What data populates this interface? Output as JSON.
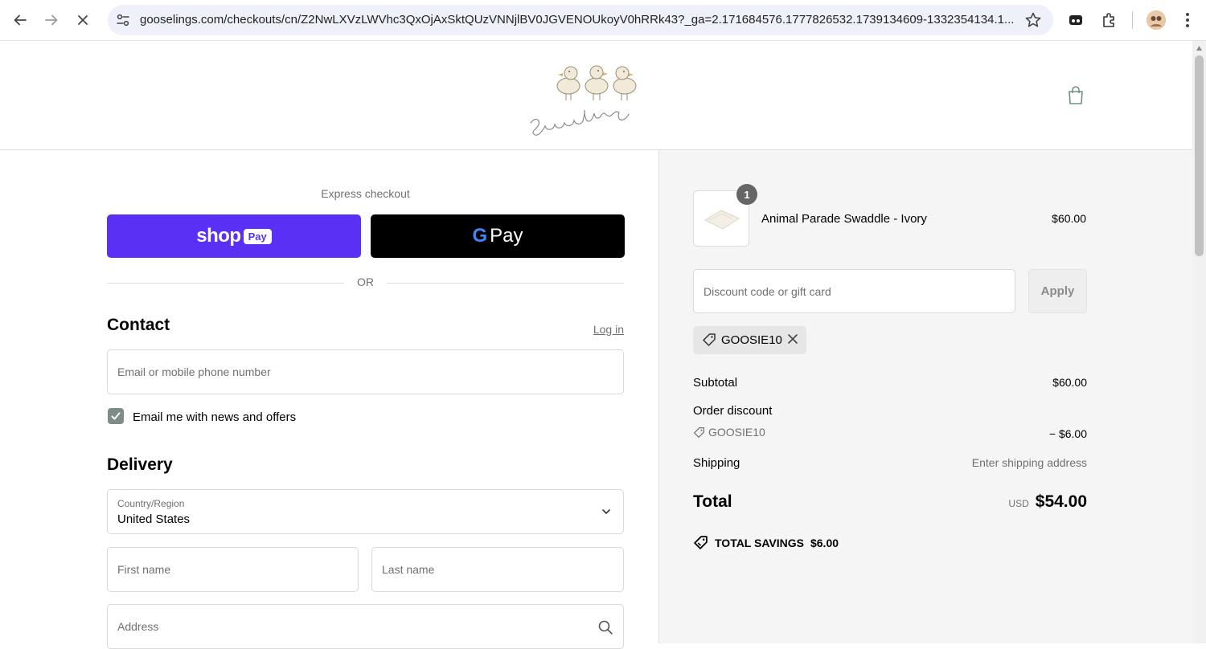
{
  "browser": {
    "url": "gooselings.com/checkouts/cn/Z2NwLXVzLWVhc3QxOjAxSktQUzVNNjlBV0JGVENOUkoyV0hRRk43?_ga=2.171684576.1777826532.1739134609-1332354134.1..."
  },
  "logo": {
    "text": "gooselings"
  },
  "express": {
    "label": "Express checkout",
    "shoppay_word": "shop",
    "shoppay_pill": "Pay",
    "gpay_g": "G",
    "gpay_word": "Pay",
    "or": "OR"
  },
  "contact": {
    "title": "Contact",
    "login": "Log in",
    "email_placeholder": "Email or mobile phone number",
    "newsletter_label": "Email me with news and offers",
    "newsletter_checked": true
  },
  "delivery": {
    "title": "Delivery",
    "country_label": "Country/Region",
    "country_value": "United States",
    "first_name_placeholder": "First name",
    "last_name_placeholder": "Last name",
    "address_placeholder": "Address"
  },
  "order": {
    "item": {
      "quantity": "1",
      "name": "Animal Parade Swaddle - Ivory",
      "price": "$60.00"
    },
    "discount_placeholder": "Discount code or gift card",
    "apply_label": "Apply",
    "applied_code": "GOOSIE10",
    "subtotal_label": "Subtotal",
    "subtotal_value": "$60.00",
    "discount_label": "Order discount",
    "discount_code": "GOOSIE10",
    "discount_value": "− $6.00",
    "shipping_label": "Shipping",
    "shipping_value": "Enter shipping address",
    "total_label": "Total",
    "currency": "USD",
    "total_value": "$54.00",
    "savings_label": "TOTAL SAVINGS",
    "savings_value": "$6.00"
  },
  "colors": {
    "shop_pay": "#5a31f4",
    "gpay": "#000000",
    "checkbox": "#7e8e86",
    "summary_bg": "#f5f5f5"
  }
}
